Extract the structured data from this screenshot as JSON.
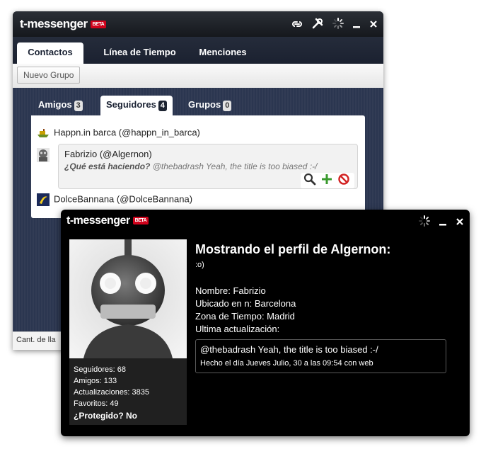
{
  "main_window": {
    "logo": "t-messenger",
    "beta": "BETA",
    "nav_tabs": [
      "Contactos",
      "Línea de Tiempo",
      "Menciones"
    ],
    "toolbar": {
      "new_group": "Nuevo Grupo"
    },
    "sub_tabs": [
      {
        "label": "Amigos",
        "count": "3"
      },
      {
        "label": "Seguidores",
        "count": "4"
      },
      {
        "label": "Grupos",
        "count": "0"
      }
    ],
    "contacts": [
      {
        "name": "Happn.in barca (@happn_in_barca)"
      },
      {
        "name": "Fabrizio (@Algernon)",
        "status_label": "¿Qué está haciendo?",
        "status_text": "@thebadrash Yeah, the title is too biased :-/"
      },
      {
        "name": "DolceBannana (@DolceBannana)"
      }
    ],
    "status_bar": "Cant. de lla"
  },
  "profile_window": {
    "logo": "t-messenger",
    "beta": "BETA",
    "heading": "Mostrando el perfil de Algernon:",
    "tagline": ":o)",
    "info": {
      "name": "Nombre: Fabrizio",
      "location": "Ubicado en n: Barcelona",
      "timezone": "Zona de Tiempo: Madrid",
      "last_update": "Ultima actualización:"
    },
    "last_tweet": {
      "text": "@thebadrash Yeah, the title is too biased :-/",
      "meta": "Hecho el día Jueves Julio, 30 a las 09:54 con web"
    },
    "stats": {
      "followers": "Seguidores: 68",
      "friends": "Amigos: 133",
      "updates": "Actualizaciones: 3835",
      "favorites": "Favoritos: 49",
      "protected": "¿Protegido? No"
    }
  },
  "icons": [
    "link-icon",
    "tools-icon",
    "spinner-icon",
    "minimize-icon",
    "close-icon",
    "search-icon",
    "add-icon",
    "block-icon"
  ],
  "colors": {
    "brand_red": "#d0021b",
    "navy": "#1c2331",
    "add_green": "#3a9a2e",
    "block_red": "#d22222"
  }
}
